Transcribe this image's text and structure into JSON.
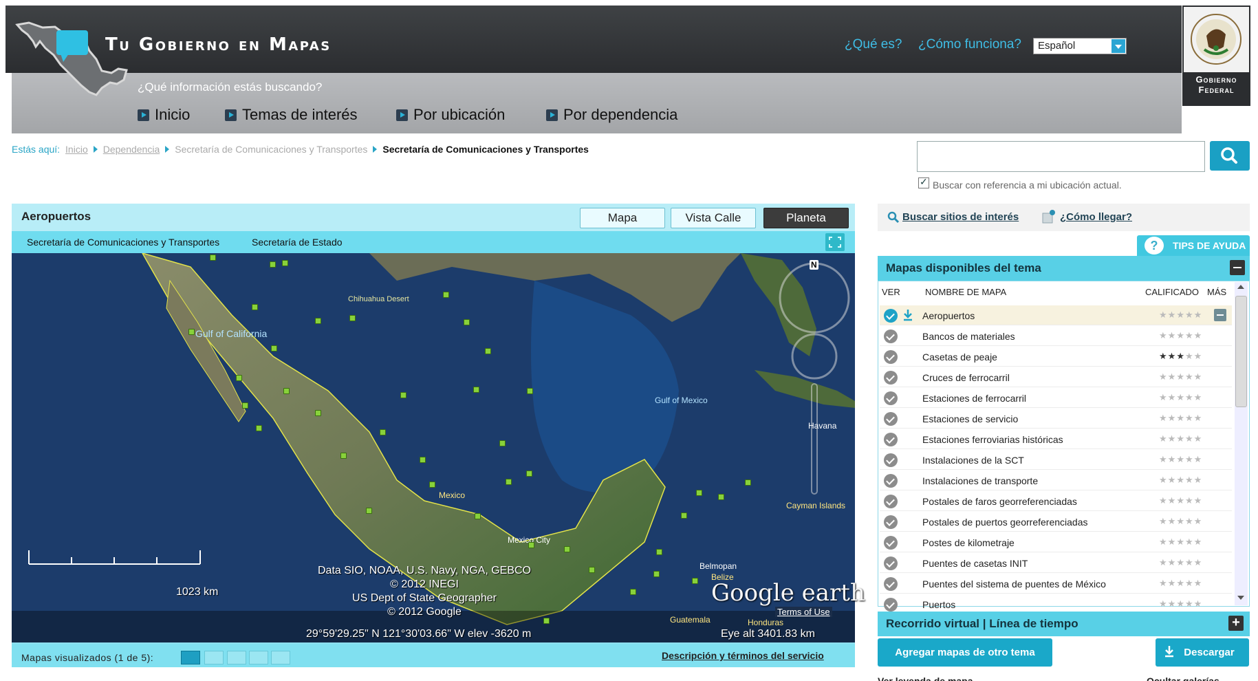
{
  "header": {
    "site_title": "Tu Gobierno en Mapas",
    "search_prompt": "¿Qué información estás buscando?",
    "links": {
      "what_is": "¿Qué es?",
      "how_it_works": "¿Cómo funciona?"
    },
    "language": "Español",
    "gov_label_line1": "Gobierno",
    "gov_label_line2": "Federal",
    "nav": [
      "Inicio",
      "Temas de interés",
      "Por ubicación",
      "Por dependencia"
    ]
  },
  "breadcrumb": {
    "prefix": "Estás aquí:",
    "items": [
      "Inicio",
      "Dependencia",
      "Secretaría de Comunicaciones y Transportes",
      "Secretaría de Comunicaciones y Transportes"
    ]
  },
  "search": {
    "placeholder": "",
    "reference_label": "Buscar con referencia a mi ubicación actual.",
    "reference_checked": true
  },
  "map_panel": {
    "title": "Aeropuertos",
    "views": [
      "Mapa",
      "Vista Calle",
      "Planeta"
    ],
    "active_view": "Planeta",
    "sources": [
      "Secretaría de Comunicaciones y Transportes",
      "Secretaría de Estado"
    ],
    "labels": {
      "gulf_california": "Gulf of California",
      "chihuahua": "Chihuahua Desert",
      "gulf_mexico": "Gulf of Mexico",
      "havana": "Havana",
      "cayman": "Cayman Islands",
      "mexico": "Mexico",
      "mexico_city": "Mexico City",
      "belmopan": "Belmopan",
      "belize": "Belize",
      "guatemala": "Guatemala",
      "honduras": "Honduras",
      "north": "N"
    },
    "attribution": [
      "Data SIO, NOAA, U.S. Navy, NGA, GEBCO",
      "© 2012 INEGI",
      "US Dept of State Geographer",
      "© 2012 Google"
    ],
    "scale": "1023 km",
    "coordinates": "29°59'29.25\" N 121°30'03.66\" W elev -3620 m",
    "eye_alt": "Eye alt  3401.83 km",
    "google_earth": "Google earth",
    "terms_of_use": "Terms of Use",
    "footer": {
      "maps_visualized": "Mapas visualizados (1 de 5):",
      "terms_link": "Descripción y términos del servicio"
    }
  },
  "right_column": {
    "tools": {
      "search_sites": "Buscar sitios de interés",
      "how_to_get": "¿Cómo llegar?"
    },
    "help_tab": "TIPS DE AYUDA",
    "maps_panel": {
      "title": "Mapas disponibles del tema",
      "columns": [
        "VER",
        "NOMBRE DE MAPA",
        "CALIFICADO",
        "MÁS"
      ],
      "rows": [
        {
          "name": "Aeropuertos",
          "stars": "★★★★★",
          "rating": 0,
          "selected": true
        },
        {
          "name": "Bancos de materiales",
          "stars": "★★★★★",
          "rating": 0
        },
        {
          "name": "Casetas de peaje",
          "stars": "★★★★★",
          "rating": 3
        },
        {
          "name": "Cruces de ferrocarril",
          "stars": "★★★★★",
          "rating": 0
        },
        {
          "name": "Estaciones de ferrocarril",
          "stars": "★★★★★",
          "rating": 0
        },
        {
          "name": "Estaciones de servicio",
          "stars": "★★★★★",
          "rating": 0
        },
        {
          "name": "Estaciones ferroviarias históricas",
          "stars": "★★★★★",
          "rating": 0
        },
        {
          "name": "Instalaciones de la SCT",
          "stars": "★★★★★",
          "rating": 0
        },
        {
          "name": "Instalaciones de transporte",
          "stars": "★★★★★",
          "rating": 0
        },
        {
          "name": "Postales de faros georreferenciadas",
          "stars": "★★★★★",
          "rating": 0
        },
        {
          "name": "Postales de puertos georreferenciadas",
          "stars": "★★★★★",
          "rating": 0
        },
        {
          "name": "Postes de kilometraje",
          "stars": "★★★★★",
          "rating": 0
        },
        {
          "name": "Puentes de casetas INIT",
          "stars": "★★★★★",
          "rating": 0
        },
        {
          "name": "Puentes del sistema de puentes de México",
          "stars": "★★★★★",
          "rating": 0
        },
        {
          "name": "Puertos",
          "stars": "★★★★★",
          "rating": 0
        }
      ]
    },
    "tour_title": "Recorrido virtual | Línea de tiempo",
    "add_maps": "Agregar mapas de otro tema",
    "download": "Descargar",
    "legend_link": "Ver leyenda de mapa",
    "hide_gallery": "Ocultar galerías"
  },
  "colors": {
    "accent": "#58d0e6",
    "button": "#1aa8c9",
    "header_dark": "#2b2d30",
    "star_filled": "#333333",
    "star_empty": "#bbbbbb"
  }
}
